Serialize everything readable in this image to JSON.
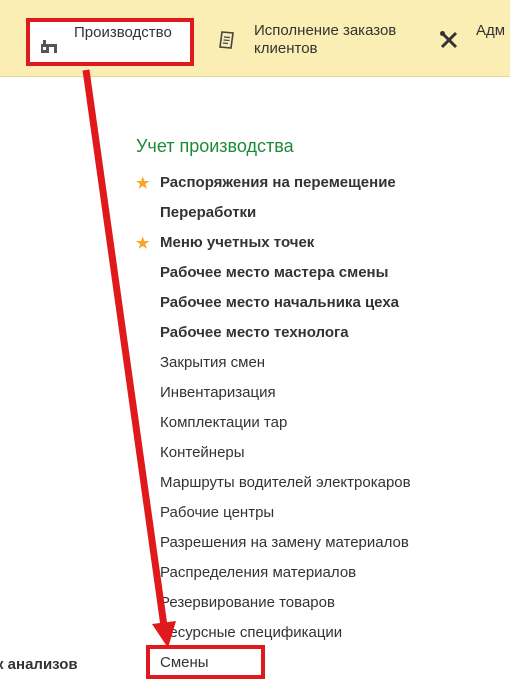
{
  "topbar": {
    "sections": [
      {
        "label": "Производство",
        "icon": "factory-icon"
      },
      {
        "label": "Исполнение заказов\nклиентов",
        "icon": "order-document-icon"
      },
      {
        "label": "Адм",
        "icon": "tools-icon"
      }
    ]
  },
  "main": {
    "group_title": "Учет производства",
    "items": [
      {
        "label": "Распоряжения на перемещение",
        "bold": true,
        "favorite": true
      },
      {
        "label": "Переработки",
        "bold": true,
        "favorite": false
      },
      {
        "label": "Меню учетных точек",
        "bold": true,
        "favorite": true
      },
      {
        "label": "Рабочее место мастера смены",
        "bold": true,
        "favorite": false
      },
      {
        "label": "Рабочее место начальника цеха",
        "bold": true,
        "favorite": false
      },
      {
        "label": "Рабочее место технолога",
        "bold": true,
        "favorite": false
      },
      {
        "label": "Закрытия смен",
        "bold": false,
        "favorite": false
      },
      {
        "label": "Инвентаризация",
        "bold": false,
        "favorite": false
      },
      {
        "label": "Комплектации тар",
        "bold": false,
        "favorite": false
      },
      {
        "label": "Контейнеры",
        "bold": false,
        "favorite": false
      },
      {
        "label": "Маршруты водителей электрокаров",
        "bold": false,
        "favorite": false
      },
      {
        "label": "Рабочие центры",
        "bold": false,
        "favorite": false
      },
      {
        "label": "Разрешения на замену материалов",
        "bold": false,
        "favorite": false
      },
      {
        "label": "Распределения материалов",
        "bold": false,
        "favorite": false
      },
      {
        "label": "Резервирование товаров",
        "bold": false,
        "favorite": false
      },
      {
        "label": "Ресурсные спецификации",
        "bold": false,
        "favorite": false
      },
      {
        "label": "Смены",
        "bold": false,
        "favorite": false
      }
    ],
    "star_glyph": "★"
  },
  "left_panel": {
    "clipped_text": "к анализов"
  },
  "colors": {
    "topbar_bg": "#fbeeb5",
    "group_title": "#1e8a35",
    "star": "#f5a623",
    "annotation_red": "#e0191c"
  }
}
